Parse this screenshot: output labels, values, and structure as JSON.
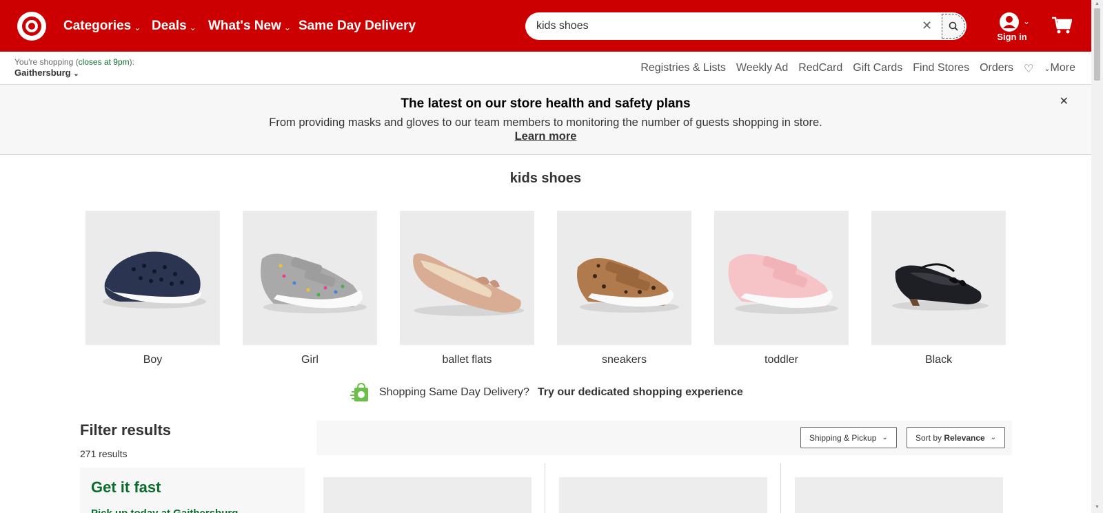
{
  "header": {
    "nav": {
      "categories": "Categories",
      "deals": "Deals",
      "whats_new": "What's New",
      "same_day": "Same Day Delivery"
    },
    "search": {
      "value": "kids shoes",
      "placeholder": ""
    },
    "sign_in": "Sign in",
    "brand_color": "#cc0000"
  },
  "subbar": {
    "shopping_prefix": "You're shopping (",
    "hours": "closes at 9pm",
    "shopping_suffix": "):",
    "store": "Gaithersburg",
    "links": [
      "Registries & Lists",
      "Weekly Ad",
      "RedCard",
      "Gift Cards",
      "Find Stores",
      "Orders"
    ],
    "more": "More"
  },
  "banner": {
    "title": "The latest on our store health and safety plans",
    "text": "From providing masks and gloves to our team members to monitoring the number of guests shopping in store.",
    "link": "Learn more"
  },
  "query": "kids shoes",
  "tiles": [
    "Boy",
    "Girl",
    "ballet flats",
    "sneakers",
    "toddler",
    "Black"
  ],
  "sdd": {
    "text": "Shopping Same Day Delivery?",
    "cta": "Try our dedicated shopping experience"
  },
  "filters": {
    "title": "Filter results",
    "count": "271 results",
    "get_fast": "Get it fast",
    "pickup": "Pick up today at Gaithersburg"
  },
  "sort": {
    "shipping": "Shipping & Pickup",
    "sort_prefix": "Sort by ",
    "sort_value": "Relevance"
  },
  "colors": {
    "accent_green": "#0a6b2c"
  }
}
